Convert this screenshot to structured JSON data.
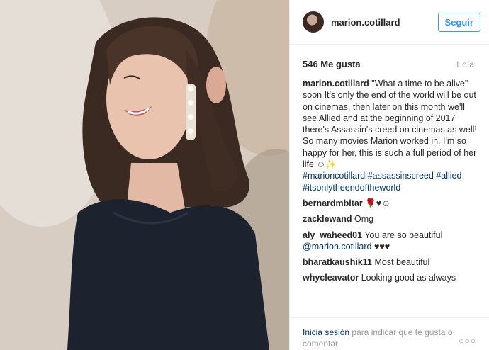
{
  "post": {
    "username": "marion.cotillard",
    "follow_label": "Seguir",
    "likes": "546 Me gusta",
    "time": "1 día",
    "caption_user": "marion.cotillard",
    "caption_text": "\"What a time to be alive\" soon It's only the end of the world will be out on cinemas, then later on this month we'll see Allied and at the beginning of 2017 there's Assassin's creed on cinemas as well! So many movies Marion worked in. I'm so happy for her, this is such a full period of her life ☺✨",
    "hashtags": [
      "#marioncotillard",
      "#assassinscreed",
      "#allied",
      "#itsonlytheendoftheworld"
    ]
  },
  "comments": [
    {
      "user": "bernardmbitar",
      "text": "🌹♥☺"
    },
    {
      "user": "zacklewand",
      "text": "Omg"
    },
    {
      "user": "aly_waheed01",
      "text": "You are so beautiful",
      "mention": "@marion.cotillard",
      "suffix": "♥♥♥"
    },
    {
      "user": "bharatkaushik11",
      "text": "Most beautiful"
    },
    {
      "user": "whycleavator",
      "text": "Looking good as always"
    }
  ],
  "footer": {
    "login_label": "Inicia sesión",
    "prompt": "para indicar que te gusta o comentar.",
    "more_label": "○○○"
  },
  "colors": {
    "accent": "#3897f0",
    "link": "#003569",
    "muted": "#999999"
  }
}
